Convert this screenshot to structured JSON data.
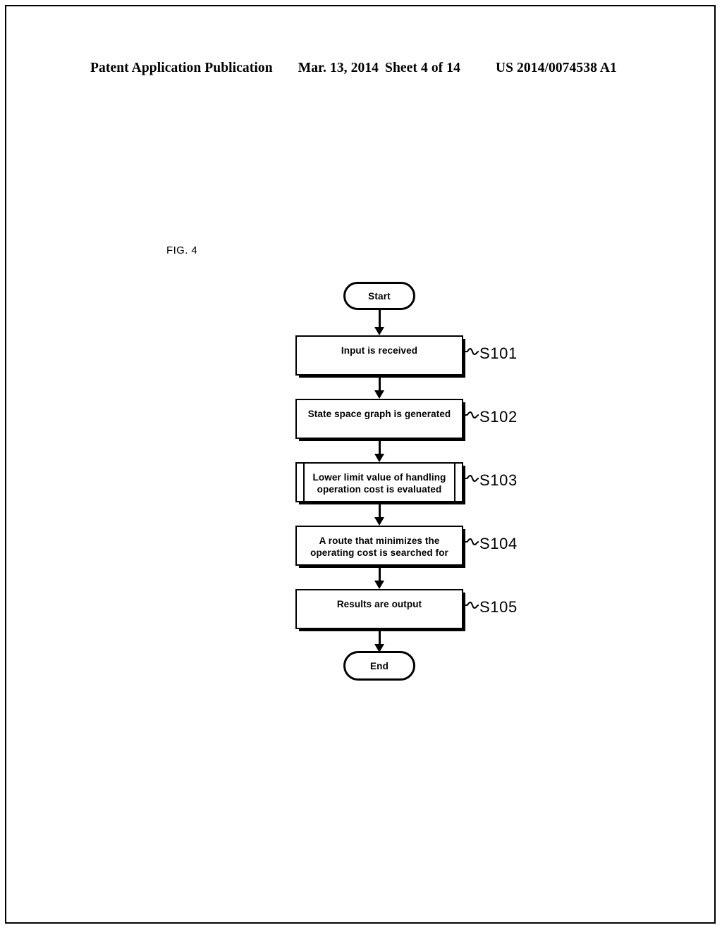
{
  "header": {
    "publication": "Patent Application Publication",
    "date": "Mar. 13, 2014",
    "sheet": "Sheet 4 of 14",
    "patent_number": "US 2014/0074538 A1"
  },
  "figure": {
    "label": "FIG. 4"
  },
  "diagram_data": {
    "type": "flowchart",
    "orientation": "vertical",
    "nodes": [
      {
        "id": "start",
        "shape": "terminator",
        "text": "Start"
      },
      {
        "id": "s101",
        "shape": "process",
        "text": "Input is received",
        "ref": "S101"
      },
      {
        "id": "s102",
        "shape": "process",
        "text": "State space graph is generated",
        "ref": "S102"
      },
      {
        "id": "s103",
        "shape": "predefined-process",
        "text_line1": "Lower limit value of handling",
        "text_line2": "operation cost is evaluated",
        "ref": "S103"
      },
      {
        "id": "s104",
        "shape": "process",
        "text_line1": "A route that minimizes the",
        "text_line2": "operating cost is searched for",
        "ref": "S104"
      },
      {
        "id": "s105",
        "shape": "process",
        "text": "Results are output",
        "ref": "S105"
      },
      {
        "id": "end",
        "shape": "terminator",
        "text": "End"
      }
    ],
    "edges": [
      {
        "from": "start",
        "to": "s101"
      },
      {
        "from": "s101",
        "to": "s102"
      },
      {
        "from": "s102",
        "to": "s103"
      },
      {
        "from": "s103",
        "to": "s104"
      },
      {
        "from": "s104",
        "to": "s105"
      },
      {
        "from": "s105",
        "to": "end"
      }
    ],
    "colors": {
      "line": "#000000",
      "fill": "#ffffff",
      "text": "#000000"
    }
  }
}
